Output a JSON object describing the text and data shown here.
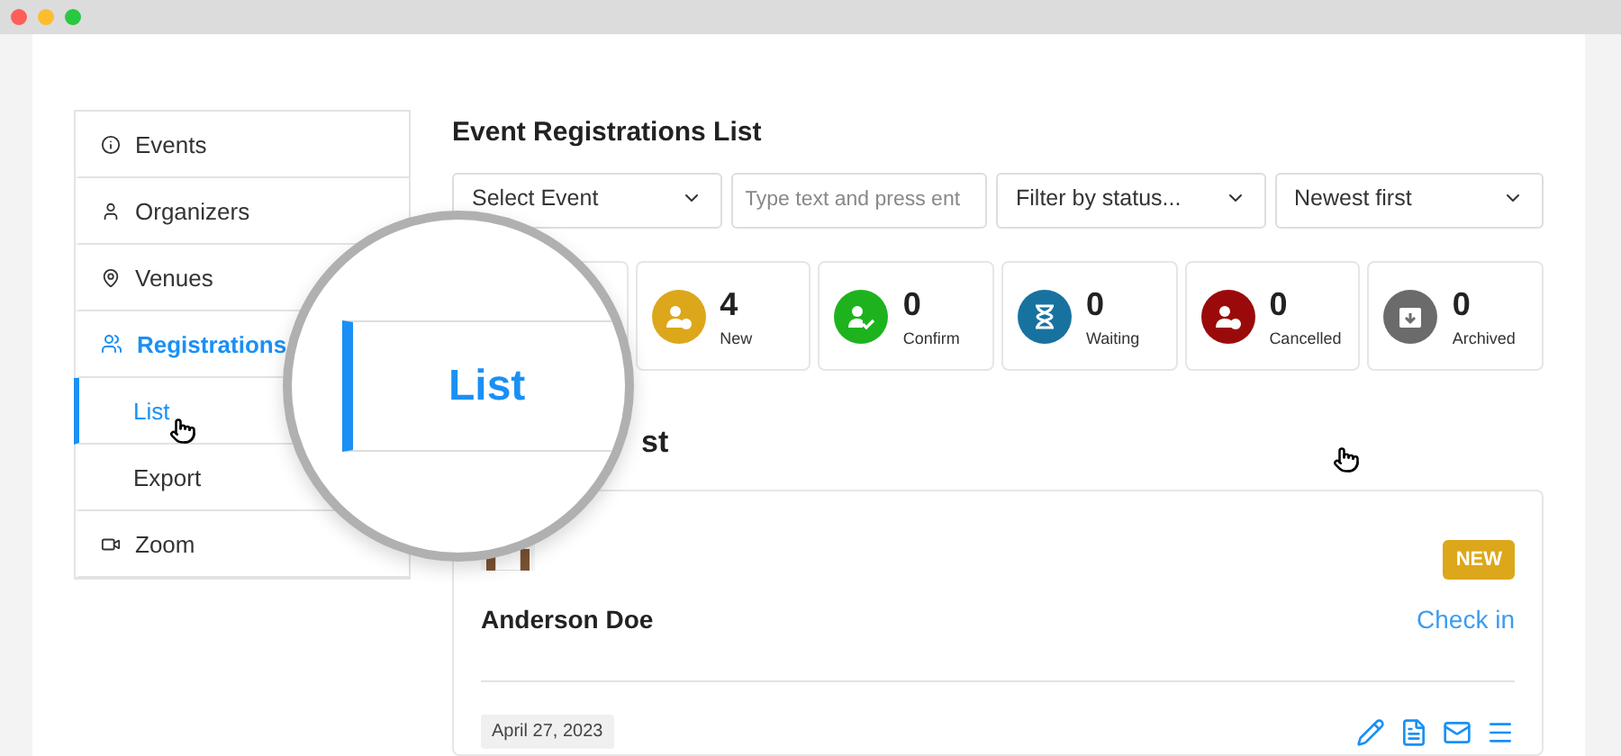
{
  "sidebar": {
    "items": [
      {
        "label": "Events",
        "selected": false
      },
      {
        "label": "Organizers",
        "selected": false
      },
      {
        "label": "Venues",
        "selected": false
      },
      {
        "label": "Registrations",
        "selected": true,
        "children": [
          {
            "label": "List",
            "selected": true
          },
          {
            "label": "Export",
            "selected": false
          }
        ]
      },
      {
        "label": "Zoom",
        "selected": false
      }
    ]
  },
  "title": "Event Registrations List",
  "filters": [
    {
      "kind": "select",
      "value": "Select Event"
    },
    {
      "kind": "input",
      "placeholder": "Type text and press ent"
    },
    {
      "kind": "select",
      "value": "Filter by status..."
    },
    {
      "kind": "select",
      "value": "Newest first"
    }
  ],
  "stats": [
    {
      "count": "4",
      "label": "New",
      "color": "#dca71b"
    },
    {
      "count": "0",
      "label": "Confirm",
      "color": "#1eb31e"
    },
    {
      "count": "0",
      "label": "Waiting",
      "color": "#1872a0"
    },
    {
      "count": "0",
      "label": "Cancelled",
      "color": "#9b0a0a"
    },
    {
      "count": "0",
      "label": "Archived",
      "color": "#6b6b6b"
    }
  ],
  "list_heading": "st",
  "magnifier": {
    "label": "List"
  },
  "registration": {
    "name": "Anderson Doe",
    "status": "NEW",
    "action": "Check in",
    "date": "April 27, 2023"
  }
}
